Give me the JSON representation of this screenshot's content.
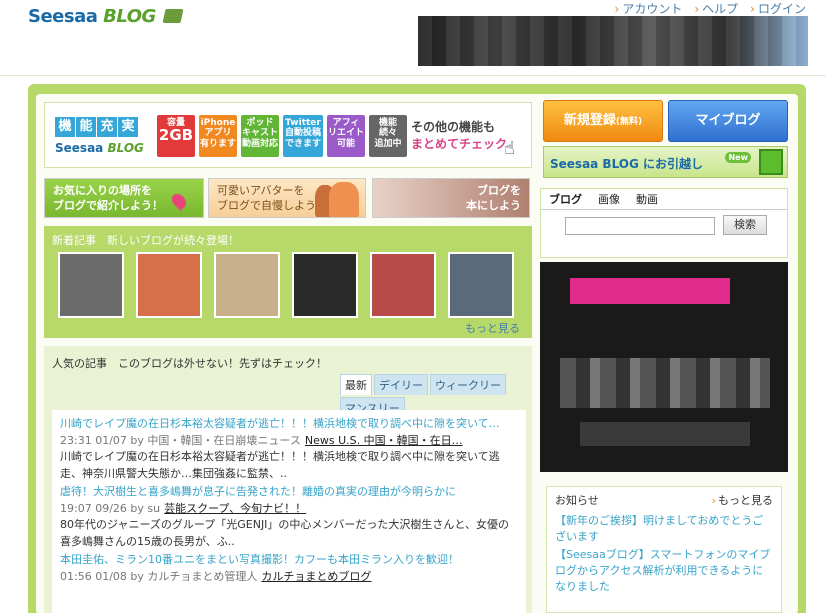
{
  "header": {
    "logo_main": "Seesaa",
    "logo_blog": "BLOG",
    "links": [
      "アカウント",
      "ヘルプ",
      "ログイン"
    ]
  },
  "features": {
    "title_chars": [
      "機",
      "能",
      "充",
      "実"
    ],
    "brand_main": "Seesaa",
    "brand_blog": "BLOG",
    "boxes": [
      {
        "top": "容量",
        "big": "2GB",
        "color": "#e23a3a"
      },
      {
        "top": "iPhone",
        "big": "アプリ",
        "bottom": "有ります",
        "color": "#f08a20"
      },
      {
        "top": "ポッド",
        "big": "キャスト",
        "bottom": "動画対応",
        "color": "#62b636"
      },
      {
        "top": "Twitter",
        "big": "自動投稿",
        "bottom": "できます",
        "color": "#34a6d8"
      },
      {
        "top": "アフィ",
        "big": "リエイト",
        "bottom": "可能",
        "color": "#9a5ac8"
      },
      {
        "top": "機能",
        "big": "続々",
        "bottom": "追加中",
        "color": "#666666"
      }
    ],
    "more_line1": "その他の機能も",
    "more_line2": "まとめてチェック"
  },
  "promos": [
    {
      "line1": "お気に入りの場所を",
      "line2": "ブログで紹介しよう！"
    },
    {
      "line1": "可愛いアバターを",
      "line2": "ブログで自慢しよう"
    },
    {
      "line1": "ブログを",
      "line2": "本にしよう"
    }
  ],
  "new_posts": {
    "heading": "新着記事　新しいブログが続々登場！",
    "more": "もっと見る",
    "thumb_colors": [
      "#6b6b6b",
      "#d66f4a",
      "#c8b08a",
      "#2a2a2a",
      "#b84a4a",
      "#5a6a7a"
    ]
  },
  "popular": {
    "heading": "人気の記事　このブログは外せない！先ずはチェック！",
    "tabs": [
      "最新",
      "デイリー",
      "ウィークリー",
      "マンスリー"
    ],
    "items": [
      {
        "title": "川崎でレイプ魔の在日杉本裕太容疑者が逃亡！！！横浜地検で取り調べ中に隙を突いて…",
        "meta": "23:31 01/07 by 中国・韓国・在日崩壊ニュース",
        "source": "News U.S. 中国・韓国・在日…",
        "desc": "川崎でレイプ魔の在日杉本裕太容疑者が逃亡！！！横浜地検で取り調べ中に隙を突いて逃走、神奈川県警大失態か…集団強姦に監禁、.."
      },
      {
        "title": "虐待！大沢樹生と喜多嶋舞が息子に告発された！離婚の真実の理由が今明らかに",
        "meta": "19:07 09/26 by su",
        "source": "芸能スクープ、今旬ナビ！！",
        "desc": "80年代のジャニーズのグループ「光GENJI」の中心メンバーだった大沢樹生さんと、女優の喜多嶋舞さんの15歳の長男が、ふ.."
      },
      {
        "title": "本田圭佑、ミラン10番ユニをまとい写真撮影！カフーも本田ミラン入りを歓迎！",
        "meta": "01:56 01/08 by カルチョまとめ管理人",
        "source": "カルチョまとめブログ",
        "desc": ""
      }
    ]
  },
  "sidebar": {
    "register": "新規登録",
    "register_small": "(無料)",
    "myblog": "マイブログ",
    "move_banner": "Seesaa BLOG にお引越し",
    "move_new": "New",
    "search_tabs": [
      "ブログ",
      "画像",
      "動画"
    ],
    "search_button": "検索",
    "search_value": ""
  },
  "notice": {
    "heading": "お知らせ",
    "more": "もっと見る",
    "items": [
      "【新年のご挨拶】明けましておめでとうございます",
      "【Seesaaブログ】スマートフォンのマイブログからアクセス解析が利用できるようになりました"
    ]
  }
}
